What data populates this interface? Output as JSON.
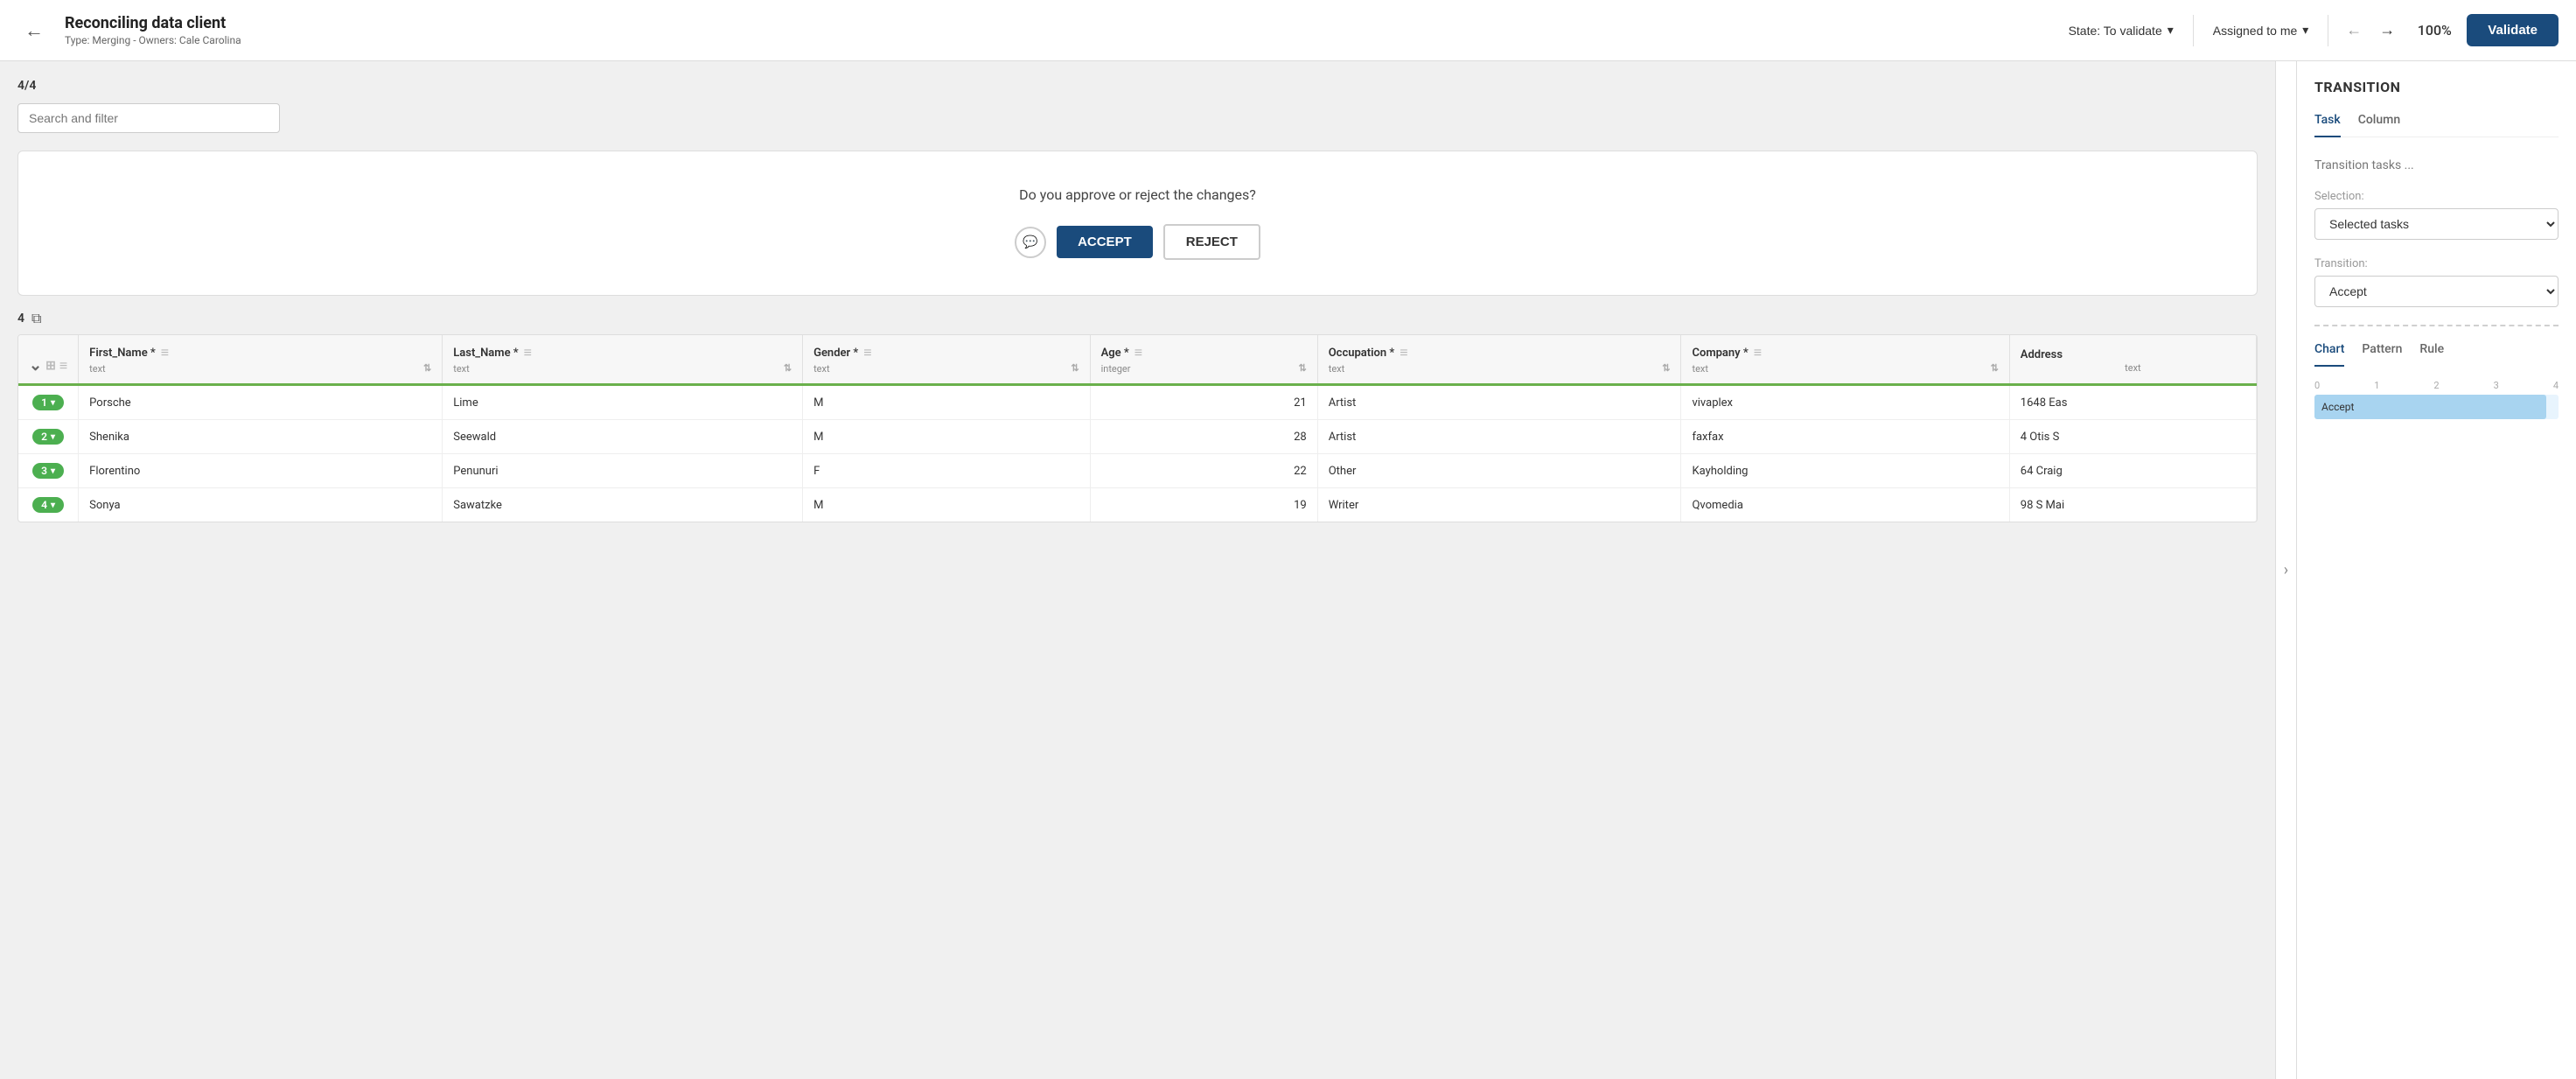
{
  "header": {
    "back_label": "←",
    "title": "Reconciling data client",
    "subtitle": "Type: Merging - Owners: Cale Carolina",
    "state_label": "State: To validate",
    "assigned_label": "Assigned to me",
    "nav_left": "←",
    "nav_right": "→",
    "zoom": "100%",
    "validate_label": "Validate"
  },
  "left": {
    "counter": "4/4",
    "search_placeholder": "Search and filter",
    "approve_question": "Do you approve or reject the changes?",
    "accept_label": "ACCEPT",
    "reject_label": "REJECT",
    "row_count": "4",
    "table": {
      "columns": [
        {
          "name": "First_Name *",
          "type": "text"
        },
        {
          "name": "Last_Name *",
          "type": "text"
        },
        {
          "name": "Gender *",
          "type": "text"
        },
        {
          "name": "Age *",
          "type": "integer"
        },
        {
          "name": "Occupation *",
          "type": "text"
        },
        {
          "name": "Company *",
          "type": "text"
        },
        {
          "name": "Address",
          "type": "text"
        }
      ],
      "rows": [
        {
          "id": "1",
          "first_name": "Porsche",
          "last_name": "Lime",
          "gender": "M",
          "age": "21",
          "occupation": "Artist",
          "company": "vivaplex",
          "address": "1648 Eas"
        },
        {
          "id": "2",
          "first_name": "Shenika",
          "last_name": "Seewald",
          "gender": "M",
          "age": "28",
          "occupation": "Artist",
          "company": "faxfax",
          "address": "4 Otis S"
        },
        {
          "id": "3",
          "first_name": "Florentino",
          "last_name": "Penunuri",
          "gender": "F",
          "age": "22",
          "occupation": "Other",
          "company": "Kayholding",
          "address": "64 Craig"
        },
        {
          "id": "4",
          "first_name": "Sonya",
          "last_name": "Sawatzke",
          "gender": "M",
          "age": "19",
          "occupation": "Writer",
          "company": "Qvomedia",
          "address": "98 S Mai"
        }
      ]
    }
  },
  "right": {
    "title": "TRANSITION",
    "tabs": [
      "Task",
      "Column"
    ],
    "active_tab": "Task",
    "transition_placeholder": "Transition tasks ...",
    "selection_label": "Selection:",
    "selection_value": "Selected tasks",
    "transition_label": "Transition:",
    "transition_value": "Accept",
    "chart_tabs": [
      "Chart",
      "Pattern",
      "Rule"
    ],
    "active_chart_tab": "Chart",
    "chart_axis": [
      "0",
      "1",
      "2",
      "3",
      "4"
    ],
    "chart_bar_label": "Accept",
    "chart_bar_percent": 95
  }
}
